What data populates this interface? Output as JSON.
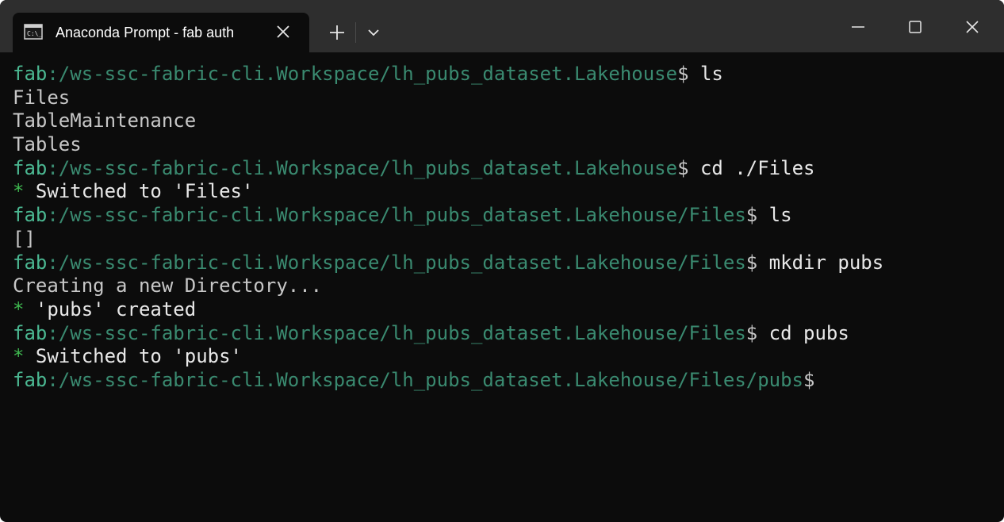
{
  "titlebar": {
    "tab_title": "Anaconda Prompt - fab  auth",
    "tab_icon": "cmd-prompt-icon",
    "new_tab_icon": "plus-icon",
    "dropdown_icon": "chevron-down-icon",
    "window_controls": [
      "minimize-icon",
      "maximize-icon",
      "close-icon"
    ]
  },
  "colors": {
    "background": "#0c0c0c",
    "titlebar": "#2e2e2e",
    "prompt_fab": "#4bb892",
    "prompt_path": "#3a8a70",
    "text": "#c7c7c7",
    "command": "#e8e8e8",
    "success_star": "#3fb950"
  },
  "terminal": {
    "lines": [
      {
        "type": "prompt",
        "fab": "fab",
        "path": ":/ws-ssc-fabric-cli.Workspace/lh_pubs_dataset.Lakehouse",
        "dollar": "$",
        "cmd": " ls"
      },
      {
        "type": "output",
        "text": "Files"
      },
      {
        "type": "output",
        "text": "TableMaintenance"
      },
      {
        "type": "output",
        "text": "Tables"
      },
      {
        "type": "prompt",
        "fab": "fab",
        "path": ":/ws-ssc-fabric-cli.Workspace/lh_pubs_dataset.Lakehouse",
        "dollar": "$",
        "cmd": " cd ./Files"
      },
      {
        "type": "success",
        "star": "*",
        "text": " Switched to 'Files'"
      },
      {
        "type": "prompt",
        "fab": "fab",
        "path": ":/ws-ssc-fabric-cli.Workspace/lh_pubs_dataset.Lakehouse/Files",
        "dollar": "$",
        "cmd": " ls"
      },
      {
        "type": "output",
        "text": "[]"
      },
      {
        "type": "prompt",
        "fab": "fab",
        "path": ":/ws-ssc-fabric-cli.Workspace/lh_pubs_dataset.Lakehouse/Files",
        "dollar": "$",
        "cmd": " mkdir pubs"
      },
      {
        "type": "output",
        "text": "Creating a new Directory..."
      },
      {
        "type": "success",
        "star": "*",
        "text": " 'pubs' created"
      },
      {
        "type": "prompt",
        "fab": "fab",
        "path": ":/ws-ssc-fabric-cli.Workspace/lh_pubs_dataset.Lakehouse/Files",
        "dollar": "$",
        "cmd": " cd pubs"
      },
      {
        "type": "success",
        "star": "*",
        "text": " Switched to 'pubs'"
      },
      {
        "type": "prompt",
        "fab": "fab",
        "path": ":/ws-ssc-fabric-cli.Workspace/lh_pubs_dataset.Lakehouse/Files/pubs",
        "dollar": "$",
        "cmd": ""
      }
    ]
  }
}
